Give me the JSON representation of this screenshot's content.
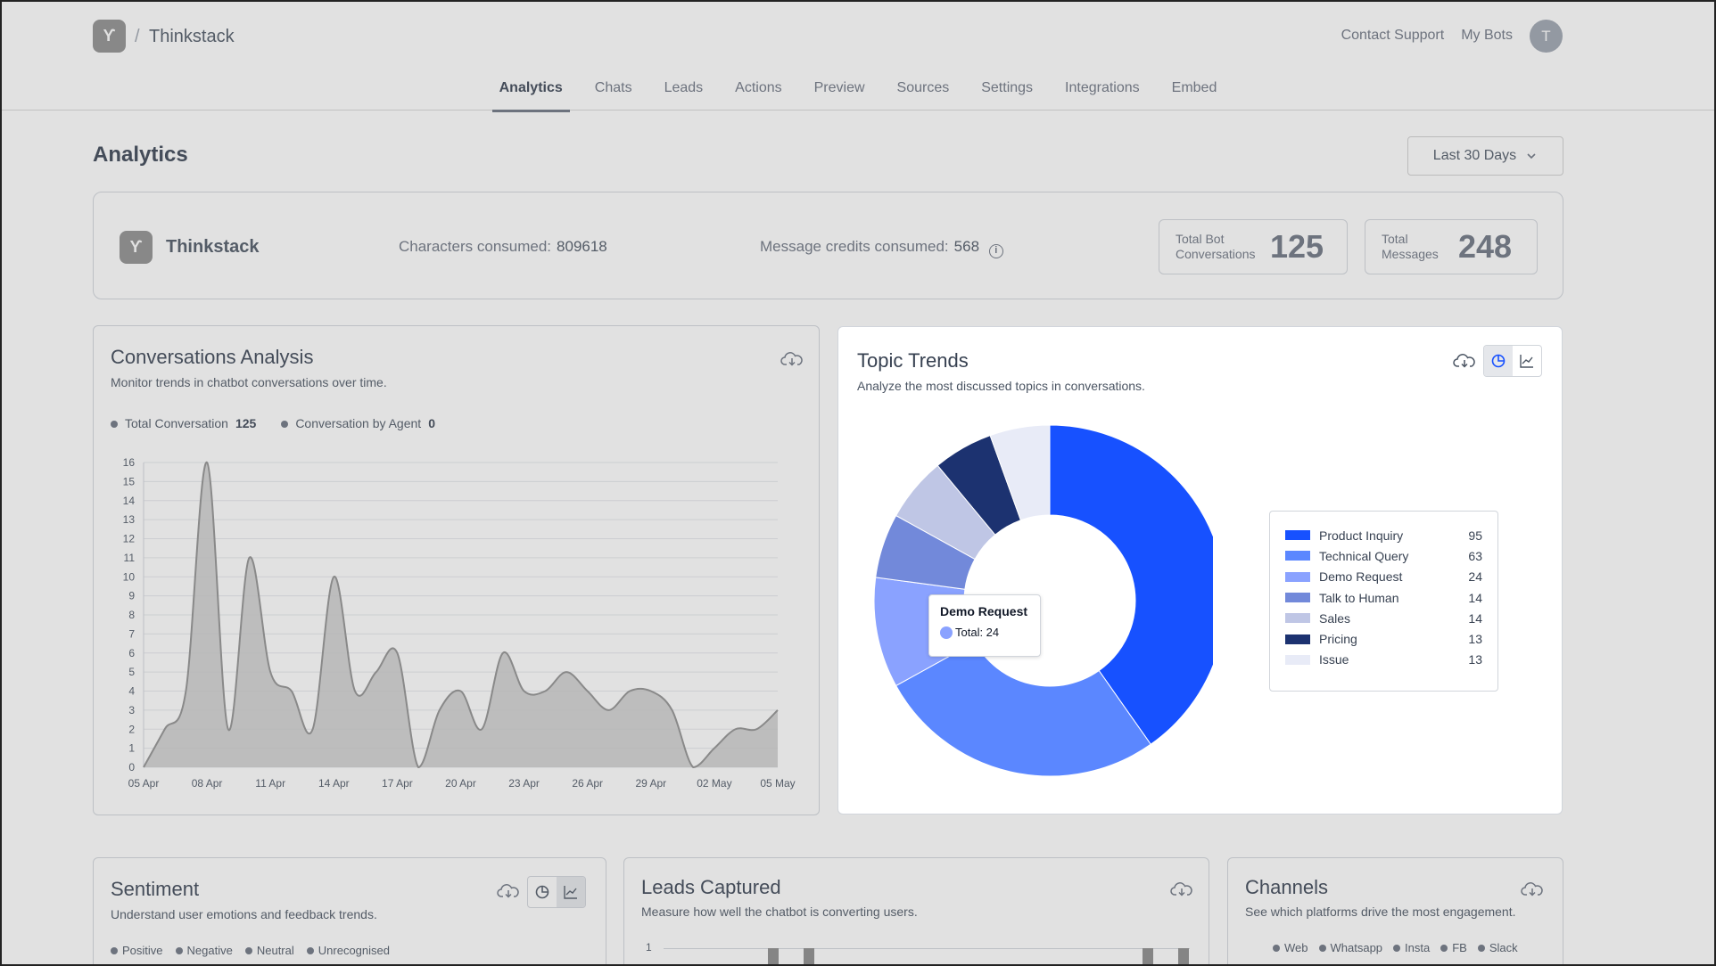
{
  "header": {
    "brand": "Thinkstack",
    "contact_support": "Contact Support",
    "my_bots": "My Bots",
    "avatar_initial": "T",
    "logo_glyph": "ϒ"
  },
  "tabs": [
    "Analytics",
    "Chats",
    "Leads",
    "Actions",
    "Preview",
    "Sources",
    "Settings",
    "Integrations",
    "Embed"
  ],
  "page": {
    "title": "Analytics",
    "date_range": "Last 30 Days"
  },
  "summary": {
    "bot_name": "Thinkstack",
    "characters_label": "Characters consumed:",
    "characters_value": "809618",
    "credits_label": "Message credits consumed:",
    "credits_value": "568",
    "kpi_conversations_label_1": "Total Bot",
    "kpi_conversations_label_2": "Conversations",
    "kpi_conversations_value": "125",
    "kpi_messages_label_1": "Total",
    "kpi_messages_label_2": "Messages",
    "kpi_messages_value": "248"
  },
  "conversations": {
    "title": "Conversations Analysis",
    "subtitle": "Monitor trends in chatbot conversations over time.",
    "legend_total_label": "Total Conversation",
    "legend_total_value": "125",
    "legend_agent_label": "Conversation by Agent",
    "legend_agent_value": "0"
  },
  "topic_trends": {
    "title": "Topic Trends",
    "subtitle": "Analyze the most discussed topics in conversations.",
    "tooltip_title": "Demo Request",
    "tooltip_value": "Total: 24"
  },
  "sentiment": {
    "title": "Sentiment",
    "subtitle": "Understand user emotions and feedback trends.",
    "legend": [
      "Positive",
      "Negative",
      "Neutral",
      "Unrecognised"
    ]
  },
  "leads": {
    "title": "Leads Captured",
    "subtitle": "Measure how well the chatbot is converting users.",
    "y_tick": "1"
  },
  "channels": {
    "title": "Channels",
    "subtitle": "See which platforms drive the most engagement.",
    "legend": [
      "Web",
      "Whatsapp",
      "Insta",
      "FB",
      "Slack"
    ]
  },
  "chart_data": [
    {
      "type": "area",
      "title": "Conversations Analysis",
      "x_ticks": [
        "05 Apr",
        "08 Apr",
        "11 Apr",
        "14 Apr",
        "17 Apr",
        "20 Apr",
        "23 Apr",
        "26 Apr",
        "29 Apr",
        "02 May",
        "05 May"
      ],
      "y_ticks": [
        0,
        1,
        2,
        3,
        4,
        5,
        6,
        7,
        8,
        9,
        10,
        11,
        12,
        13,
        14,
        15,
        16
      ],
      "ylim": [
        0,
        16
      ],
      "x": [
        0,
        1,
        2,
        3,
        4,
        5,
        6,
        7,
        8,
        9,
        10,
        11,
        12,
        13,
        14,
        15,
        16,
        17,
        18,
        19,
        20,
        21,
        22,
        23,
        24,
        25,
        26,
        27,
        28,
        29,
        30
      ],
      "series": [
        {
          "name": "Total Conversation",
          "values": [
            0,
            2,
            4,
            16,
            2,
            11,
            5,
            4,
            2,
            10,
            4,
            5,
            6,
            0,
            3,
            4,
            2,
            6,
            4,
            4,
            5,
            4,
            3,
            4,
            4,
            3,
            0,
            1,
            2,
            2,
            3
          ]
        }
      ],
      "grid": true
    },
    {
      "type": "pie",
      "title": "Topic Trends",
      "donut": true,
      "labels": [
        "Product Inquiry",
        "Technical Query",
        "Demo Request",
        "Talk to Human",
        "Sales",
        "Pricing",
        "Issue"
      ],
      "values": [
        95,
        63,
        24,
        14,
        14,
        13,
        13
      ],
      "colors": [
        "#1751ff",
        "#5b87ff",
        "#8aa2ff",
        "#7289da",
        "#bfc6e5",
        "#1c3270",
        "#e8ebf7"
      ],
      "legend": "right"
    }
  ]
}
